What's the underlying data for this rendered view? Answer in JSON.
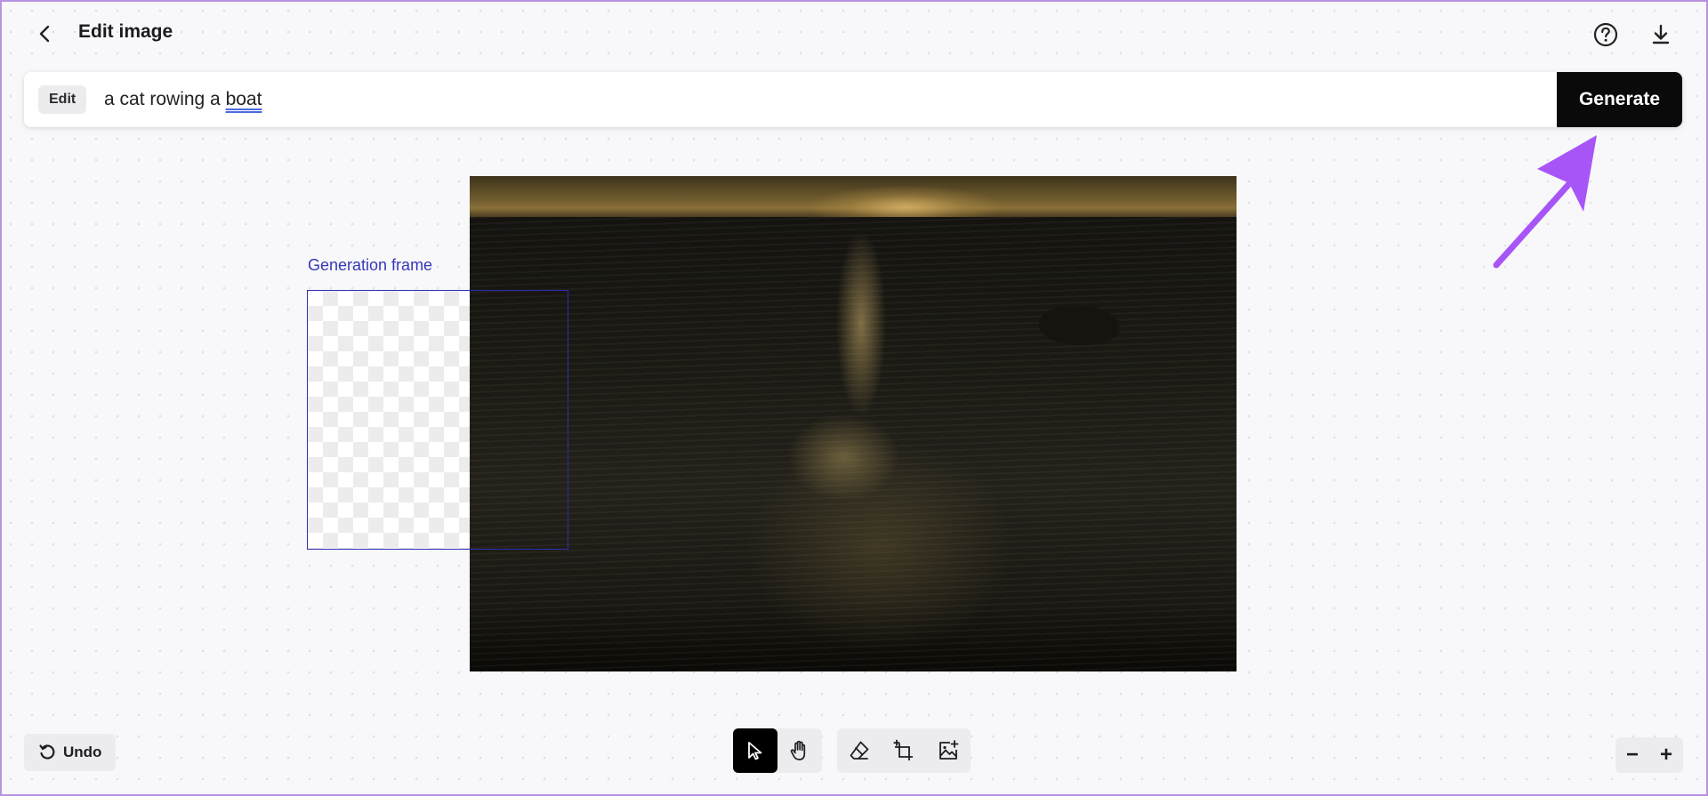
{
  "header": {
    "title": "Edit image",
    "back_icon": "chevron-left-icon",
    "help_icon": "help-circle-icon",
    "download_icon": "download-icon"
  },
  "prompt_bar": {
    "mode_badge": "Edit",
    "prompt_prefix": "a cat rowing a ",
    "prompt_misspelled_word": "boat",
    "generate_label": "Generate"
  },
  "annotation": {
    "arrow_color": "#a855f7"
  },
  "canvas": {
    "generation_frame_label": "Generation frame",
    "frame_color": "#2c2fb0"
  },
  "toolbar": {
    "undo_label": "Undo",
    "tools": [
      {
        "name": "select-tool",
        "icon": "cursor-arrow-icon",
        "active": true
      },
      {
        "name": "pan-tool",
        "icon": "hand-icon",
        "active": false
      },
      {
        "name": "eraser-tool",
        "icon": "eraser-icon",
        "active": false
      },
      {
        "name": "generation-frame-tool",
        "icon": "add-frame-icon",
        "active": false
      },
      {
        "name": "add-image-tool",
        "icon": "add-image-icon",
        "active": false
      }
    ],
    "zoom_out_label": "−",
    "zoom_in_label": "+"
  }
}
